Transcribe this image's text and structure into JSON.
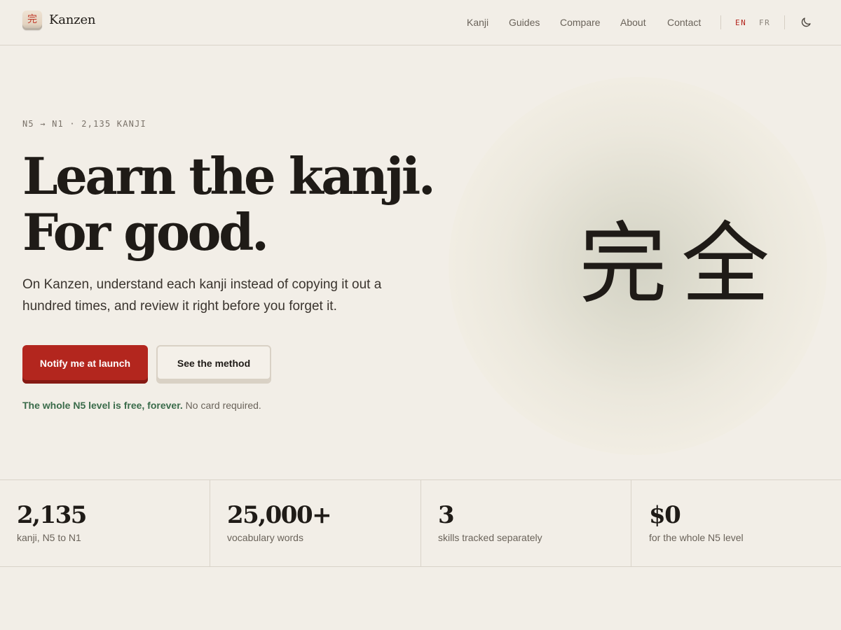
{
  "header": {
    "brand": "Kanzen",
    "logo_glyph": "完",
    "nav": [
      "Kanji",
      "Guides",
      "Compare",
      "About",
      "Contact"
    ],
    "languages": [
      {
        "label": "EN",
        "active": true
      },
      {
        "label": "FR",
        "active": false
      }
    ],
    "theme_toggle_icon": "moon-icon"
  },
  "hero": {
    "eyebrow": "N5 → N1 · 2,135 KANJI",
    "headline_line1": "Learn the kanji.",
    "headline_line2": "For good.",
    "lede": "On Kanzen, understand each kanji instead of copying it out a hundred times, and review it right before you forget it.",
    "primary_cta": "Notify me at launch",
    "secondary_cta": "See the method",
    "footnote_highlight": "The whole N5 level is free, forever.",
    "footnote_rest": "No card required.",
    "art_kanji": [
      "完",
      "全"
    ]
  },
  "stats": [
    {
      "value": "2,135",
      "label": "kanji, N5 to N1"
    },
    {
      "value": "25,000+",
      "label": "vocabulary words"
    },
    {
      "value": "3",
      "label": "skills tracked separately"
    },
    {
      "value": "$0",
      "label": "for the whole N5 level"
    }
  ],
  "colors": {
    "background": "#f2eee7",
    "accent": "#b3261e",
    "free_text": "#3a6b4a",
    "text": "#1f1b17"
  }
}
